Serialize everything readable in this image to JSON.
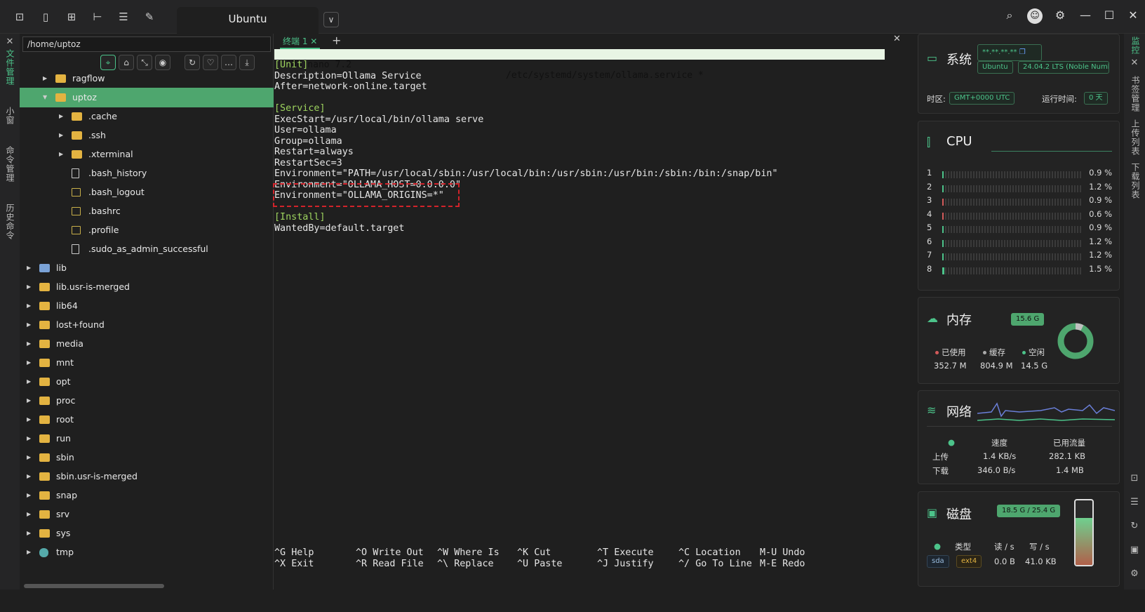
{
  "window": {
    "tab_title": "Ubuntu"
  },
  "left_tabs": [
    "文件管理",
    "小窗",
    "命令管理",
    "历史命令"
  ],
  "right_tabs": [
    "监控",
    "书签管理",
    "上传列表",
    "下载列表"
  ],
  "files": {
    "path": "/home/uptoz",
    "items": [
      {
        "name": "ragflow",
        "type": "folder",
        "level": 1
      },
      {
        "name": "uptoz",
        "type": "folder",
        "level": 1,
        "selected": true,
        "open": true
      },
      {
        "name": ".cache",
        "type": "folder",
        "level": 2
      },
      {
        "name": ".ssh",
        "type": "folder",
        "level": 2
      },
      {
        "name": ".xterminal",
        "type": "folder",
        "level": 2
      },
      {
        "name": ".bash_history",
        "type": "file",
        "level": 2
      },
      {
        "name": ".bash_logout",
        "type": "script",
        "level": 2
      },
      {
        "name": ".bashrc",
        "type": "script",
        "level": 2
      },
      {
        "name": ".profile",
        "type": "script",
        "level": 2
      },
      {
        "name": ".sudo_as_admin_successful",
        "type": "file",
        "level": 2
      },
      {
        "name": "lib",
        "type": "link",
        "level": 0
      },
      {
        "name": "lib.usr-is-merged",
        "type": "folder",
        "level": 0
      },
      {
        "name": "lib64",
        "type": "folder",
        "level": 0
      },
      {
        "name": "lost+found",
        "type": "folder",
        "level": 0
      },
      {
        "name": "media",
        "type": "folder",
        "level": 0
      },
      {
        "name": "mnt",
        "type": "folder",
        "level": 0
      },
      {
        "name": "opt",
        "type": "folder",
        "level": 0
      },
      {
        "name": "proc",
        "type": "folder",
        "level": 0
      },
      {
        "name": "root",
        "type": "folder",
        "level": 0
      },
      {
        "name": "run",
        "type": "folder",
        "level": 0
      },
      {
        "name": "sbin",
        "type": "folder",
        "level": 0
      },
      {
        "name": "sbin.usr-is-merged",
        "type": "folder",
        "level": 0
      },
      {
        "name": "snap",
        "type": "folder",
        "level": 0
      },
      {
        "name": "srv",
        "type": "folder",
        "level": 0
      },
      {
        "name": "sys",
        "type": "folder",
        "level": 0
      },
      {
        "name": "tmp",
        "type": "tmp",
        "level": 0
      }
    ]
  },
  "terminal": {
    "tab_label": "终端 1",
    "nano_version": "GNU nano 7.2",
    "file_path": "/etc/systemd/system/ollama.service *",
    "lines": [
      {
        "text": "[Unit]",
        "section": true
      },
      {
        "text": "Description=Ollama Service"
      },
      {
        "text": "After=network-online.target"
      },
      {
        "text": ""
      },
      {
        "text": "[Service]",
        "section": true
      },
      {
        "text": "ExecStart=/usr/local/bin/ollama serve"
      },
      {
        "text": "User=ollama"
      },
      {
        "text": "Group=ollama"
      },
      {
        "text": "Restart=always"
      },
      {
        "text": "RestartSec=3"
      },
      {
        "text": "Environment=\"PATH=/usr/local/sbin:/usr/local/bin:/usr/sbin:/usr/bin:/sbin:/bin:/snap/bin\""
      },
      {
        "text": "Environment=\"OLLAMA_HOST=0.0.0.0\""
      },
      {
        "text": "Environment=\"OLLAMA_ORIGINS=*\""
      },
      {
        "text": ""
      },
      {
        "text": "[Install]",
        "section": true
      },
      {
        "text": "WantedBy=default.target"
      }
    ],
    "shortcuts": [
      [
        "^G",
        "Help",
        "^X",
        "Exit"
      ],
      [
        "^O",
        "Write Out",
        "^R",
        "Read File"
      ],
      [
        "^W",
        "Where Is",
        "^\\",
        "Replace"
      ],
      [
        "^K",
        "Cut",
        "^U",
        "Paste"
      ],
      [
        "^T",
        "Execute",
        "^J",
        "Justify"
      ],
      [
        "^C",
        "Location",
        "^/",
        "Go To Line"
      ],
      [
        "M-U",
        "Undo",
        "M-E",
        "Redo"
      ]
    ]
  },
  "monitor": {
    "system": {
      "title": "系统",
      "ip": "**.**.**.**",
      "os": "Ubuntu",
      "version": "24.04.2 LTS (Noble Numbat)",
      "tz_label": "时区:",
      "tz_value": "GMT+0000  UTC",
      "uptime_label": "运行时间:",
      "uptime_value": "0 天"
    },
    "cpu": {
      "title": "CPU",
      "cores": [
        {
          "id": "1",
          "pct": "0.9 %",
          "value": 0.9,
          "color": "#4cc38a"
        },
        {
          "id": "2",
          "pct": "1.2 %",
          "value": 1.2,
          "color": "#4cc38a"
        },
        {
          "id": "3",
          "pct": "0.9 %",
          "value": 0.9,
          "color": "#d35a5a"
        },
        {
          "id": "4",
          "pct": "0.6 %",
          "value": 0.6,
          "color": "#d35a5a"
        },
        {
          "id": "5",
          "pct": "0.9 %",
          "value": 0.9,
          "color": "#4cc38a"
        },
        {
          "id": "6",
          "pct": "1.2 %",
          "value": 1.2,
          "color": "#4cc38a"
        },
        {
          "id": "7",
          "pct": "1.2 %",
          "value": 1.2,
          "color": "#4cc38a"
        },
        {
          "id": "8",
          "pct": "1.5 %",
          "value": 1.5,
          "color": "#4cc38a"
        }
      ]
    },
    "memory": {
      "title": "内存",
      "total": "15.6 G",
      "used_label": "已使用",
      "cache_label": "缓存",
      "free_label": "空闲",
      "used": "352.7 M",
      "cache": "804.9 M",
      "free": "14.5 G"
    },
    "network": {
      "title": "网络",
      "speed_label": "速度",
      "traffic_label": "已用流量",
      "up_label": "上传",
      "down_label": "下载",
      "up_speed": "1.4 KB/s",
      "up_total": "282.1 KB",
      "down_speed": "346.0 B/s",
      "down_total": "1.4 MB"
    },
    "disk": {
      "title": "磁盘",
      "usage": "18.5 G / 25.4 G",
      "type_label": "类型",
      "read_label": "读 / s",
      "write_label": "写 / s",
      "device": "sda",
      "fs": "ext4",
      "read": "0.0 B",
      "write": "41.0 KB",
      "used_fraction": 0.73
    }
  }
}
